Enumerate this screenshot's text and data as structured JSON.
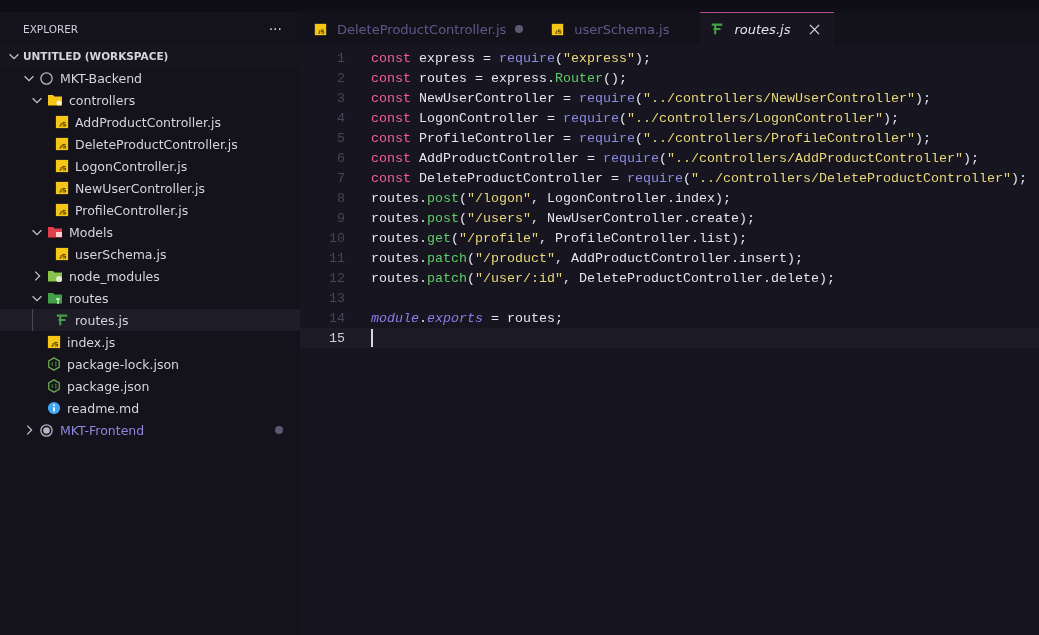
{
  "sidebar": {
    "title": "EXPLORER",
    "more": "···",
    "workspace": {
      "label": "UNTITLED (WORKSPACE)",
      "expanded": true
    },
    "tree": [
      {
        "label": "MKT-Backend",
        "kind": "root",
        "expanded": true,
        "selected": false,
        "children": [
          {
            "label": "controllers",
            "kind": "folder-gear",
            "color": "#f5c518",
            "expanded": true,
            "selected": false,
            "children": [
              {
                "label": "AddProductController.js",
                "kind": "js",
                "selected": false
              },
              {
                "label": "DeleteProductController.js",
                "kind": "js",
                "selected": false
              },
              {
                "label": "LogonController.js",
                "kind": "js",
                "selected": false
              },
              {
                "label": "NewUserController.js",
                "kind": "js",
                "selected": false
              },
              {
                "label": "ProfileController.js",
                "kind": "js",
                "selected": false
              }
            ]
          },
          {
            "label": "Models",
            "kind": "folder-db",
            "color": "#e0404a",
            "expanded": true,
            "selected": false,
            "children": [
              {
                "label": "userSchema.js",
                "kind": "js",
                "selected": false
              }
            ]
          },
          {
            "label": "node_modules",
            "kind": "folder-node",
            "color": "#8bc34a",
            "expanded": false,
            "selected": false
          },
          {
            "label": "routes",
            "kind": "folder-route",
            "color": "#43a047",
            "expanded": true,
            "selected": false,
            "children": [
              {
                "label": "routes.js",
                "kind": "routes",
                "selected": true
              }
            ]
          },
          {
            "label": "index.js",
            "kind": "js",
            "selected": false
          },
          {
            "label": "package-lock.json",
            "kind": "node",
            "selected": false
          },
          {
            "label": "package.json",
            "kind": "node",
            "selected": false
          },
          {
            "label": "readme.md",
            "kind": "info",
            "selected": false
          }
        ]
      },
      {
        "label": "MKT-Frontend",
        "kind": "root",
        "expanded": false,
        "selected": false,
        "modified": true
      }
    ]
  },
  "tabs": [
    {
      "label": "DeleteProductController.js",
      "kind": "js",
      "selected": false,
      "modified": true
    },
    {
      "label": "userSchema.js",
      "kind": "js",
      "selected": false,
      "modified": false
    },
    {
      "label": "routes.js",
      "kind": "routes",
      "selected": true,
      "modified": false
    }
  ],
  "editor": {
    "lines": [
      {
        "number": "1",
        "current": false,
        "tokens": [
          {
            "kind": "kw",
            "text": "const"
          },
          {
            "kind": "plain",
            "text": " express = "
          },
          {
            "kind": "call",
            "text": "require"
          },
          {
            "kind": "plain",
            "text": "("
          },
          {
            "kind": "str",
            "text": "\"express\""
          },
          {
            "kind": "plain",
            "text": ");"
          }
        ]
      },
      {
        "number": "2",
        "current": false,
        "tokens": [
          {
            "kind": "kw",
            "text": "const"
          },
          {
            "kind": "plain",
            "text": " routes = express."
          },
          {
            "kind": "method",
            "text": "Router"
          },
          {
            "kind": "plain",
            "text": "();"
          }
        ]
      },
      {
        "number": "3",
        "current": false,
        "tokens": [
          {
            "kind": "kw",
            "text": "const"
          },
          {
            "kind": "plain",
            "text": " NewUserController = "
          },
          {
            "kind": "call",
            "text": "require"
          },
          {
            "kind": "plain",
            "text": "("
          },
          {
            "kind": "str",
            "text": "\"../controllers/NewUserController\""
          },
          {
            "kind": "plain",
            "text": ");"
          }
        ]
      },
      {
        "number": "4",
        "current": false,
        "tokens": [
          {
            "kind": "kw",
            "text": "const"
          },
          {
            "kind": "plain",
            "text": " LogonController = "
          },
          {
            "kind": "call",
            "text": "require"
          },
          {
            "kind": "plain",
            "text": "("
          },
          {
            "kind": "str",
            "text": "\"../controllers/LogonController\""
          },
          {
            "kind": "plain",
            "text": ");"
          }
        ]
      },
      {
        "number": "5",
        "current": false,
        "tokens": [
          {
            "kind": "kw",
            "text": "const"
          },
          {
            "kind": "plain",
            "text": " ProfileController = "
          },
          {
            "kind": "call",
            "text": "require"
          },
          {
            "kind": "plain",
            "text": "("
          },
          {
            "kind": "str",
            "text": "\"../controllers/ProfileController\""
          },
          {
            "kind": "plain",
            "text": ");"
          }
        ]
      },
      {
        "number": "6",
        "current": false,
        "tokens": [
          {
            "kind": "kw",
            "text": "const"
          },
          {
            "kind": "plain",
            "text": " AddProductController = "
          },
          {
            "kind": "call",
            "text": "require"
          },
          {
            "kind": "plain",
            "text": "("
          },
          {
            "kind": "str",
            "text": "\"../controllers/AddProductController\""
          },
          {
            "kind": "plain",
            "text": ");"
          }
        ]
      },
      {
        "number": "7",
        "current": false,
        "tokens": [
          {
            "kind": "kw",
            "text": "const"
          },
          {
            "kind": "plain",
            "text": " DeleteProductController = "
          },
          {
            "kind": "call",
            "text": "require"
          },
          {
            "kind": "plain",
            "text": "("
          },
          {
            "kind": "str",
            "text": "\"../controllers/DeleteProductController\""
          },
          {
            "kind": "plain",
            "text": ");"
          }
        ]
      },
      {
        "number": "8",
        "current": false,
        "tokens": [
          {
            "kind": "plain",
            "text": "routes."
          },
          {
            "kind": "method",
            "text": "post"
          },
          {
            "kind": "plain",
            "text": "("
          },
          {
            "kind": "str",
            "text": "\"/logon\""
          },
          {
            "kind": "plain",
            "text": ", LogonController.index);"
          }
        ]
      },
      {
        "number": "9",
        "current": false,
        "tokens": [
          {
            "kind": "plain",
            "text": "routes."
          },
          {
            "kind": "method",
            "text": "post"
          },
          {
            "kind": "plain",
            "text": "("
          },
          {
            "kind": "str",
            "text": "\"/users\""
          },
          {
            "kind": "plain",
            "text": ", NewUserController.create);"
          }
        ]
      },
      {
        "number": "10",
        "current": false,
        "tokens": [
          {
            "kind": "plain",
            "text": "routes."
          },
          {
            "kind": "method",
            "text": "get"
          },
          {
            "kind": "plain",
            "text": "("
          },
          {
            "kind": "str",
            "text": "\"/profile\""
          },
          {
            "kind": "plain",
            "text": ", ProfileController.list);"
          }
        ]
      },
      {
        "number": "11",
        "current": false,
        "tokens": [
          {
            "kind": "plain",
            "text": "routes."
          },
          {
            "kind": "method",
            "text": "patch"
          },
          {
            "kind": "plain",
            "text": "("
          },
          {
            "kind": "str",
            "text": "\"/product\""
          },
          {
            "kind": "plain",
            "text": ", AddProductController.insert);"
          }
        ]
      },
      {
        "number": "12",
        "current": false,
        "tokens": [
          {
            "kind": "plain",
            "text": "routes."
          },
          {
            "kind": "method",
            "text": "patch"
          },
          {
            "kind": "plain",
            "text": "("
          },
          {
            "kind": "str",
            "text": "\"/user/:id\""
          },
          {
            "kind": "plain",
            "text": ", DeleteProductController.delete);"
          }
        ]
      },
      {
        "number": "13",
        "current": false
      },
      {
        "number": "14",
        "current": false,
        "tokens": [
          {
            "kind": "mod",
            "text": "module"
          },
          {
            "kind": "plain",
            "text": "."
          },
          {
            "kind": "mod",
            "text": "exports"
          },
          {
            "kind": "plain",
            "text": " = routes;"
          }
        ]
      },
      {
        "number": "15",
        "current": true
      }
    ]
  }
}
